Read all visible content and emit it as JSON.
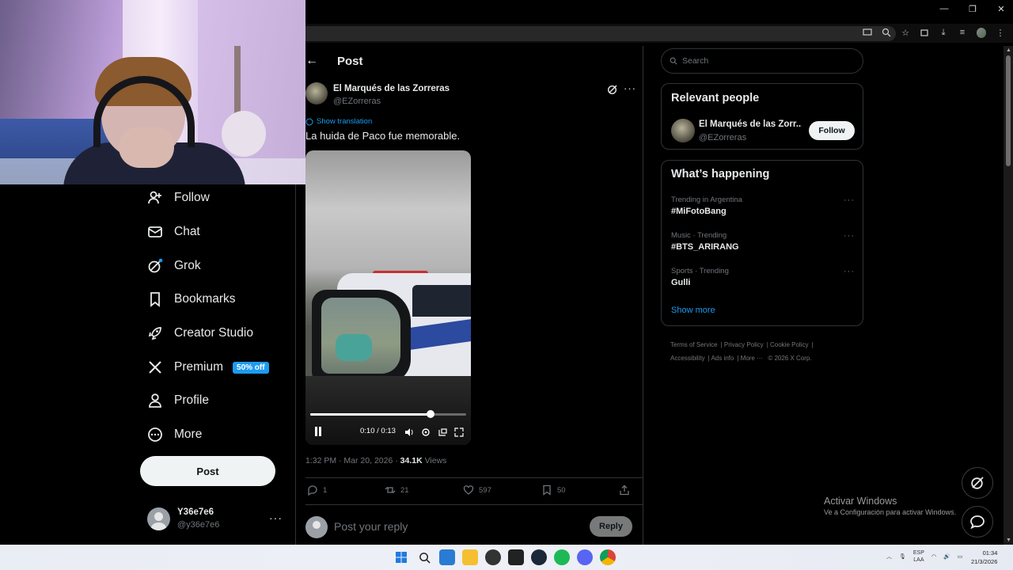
{
  "colors": {
    "accent": "#1d9bf0",
    "background": "#000000",
    "border": "#2f3336",
    "muted": "#71767b",
    "text": "#e7e9ea"
  },
  "nav": {
    "items": [
      {
        "label": "Follow",
        "icon": "follow-icon"
      },
      {
        "label": "Chat",
        "icon": "chat-icon"
      },
      {
        "label": "Grok",
        "icon": "grok-icon"
      },
      {
        "label": "Bookmarks",
        "icon": "bookmark-icon"
      },
      {
        "label": "Creator Studio",
        "icon": "rocket-icon"
      },
      {
        "label": "Premium",
        "icon": "x-logo-icon",
        "badge": "50% off"
      },
      {
        "label": "Profile",
        "icon": "profile-icon"
      },
      {
        "label": "More",
        "icon": "more-circle-icon"
      }
    ],
    "post_button": "Post",
    "user": {
      "name": "Y36e7e6",
      "handle": "@y36e7e6",
      "more": "···"
    }
  },
  "post": {
    "header_title": "Post",
    "author_name": "El Marqués de las Zorreras",
    "author_handle": "@EZorreras",
    "more": "···",
    "translate_label": "Show translation",
    "text": "La huida de Paco fue memorable.",
    "video": {
      "time": "0:10 / 0:13",
      "progress": 0.77
    },
    "meta_time": "1:32 PM · Mar 20, 2026 · ",
    "views_count": "34.1K",
    "views_label": " Views",
    "stats": {
      "replies": "1",
      "reposts": "21",
      "likes": "597",
      "bookmarks": "50"
    },
    "reply_placeholder": "Post your reply",
    "reply_button": "Reply"
  },
  "sidebar": {
    "search_placeholder": "Search",
    "relevant": {
      "title": "Relevant people",
      "name": "El Marqués de las Zorr...",
      "handle": "@EZorreras",
      "follow": "Follow"
    },
    "happening": {
      "title": "What’s happening",
      "trends": [
        {
          "category": "Trending in Argentina",
          "name": "#MiFotoBang"
        },
        {
          "category": "Music · Trending",
          "name": "#BTS_ARIRANG"
        },
        {
          "category": "Sports · Trending",
          "name": "Gulli"
        }
      ],
      "show_more": "Show more"
    },
    "footer": {
      "links": [
        "Terms of Service",
        "Privacy Policy",
        "Cookie Policy",
        "Accessibility",
        "Ads info",
        "More ···",
        "© 2026 X Corp."
      ]
    }
  },
  "windows": {
    "activate_title": "Activar Windows",
    "activate_sub": "Ve a Configuración para activar Windows.",
    "lang_top": "ESP",
    "lang_bottom": "LAA",
    "time": "01:34",
    "date": "21/3/2026"
  }
}
